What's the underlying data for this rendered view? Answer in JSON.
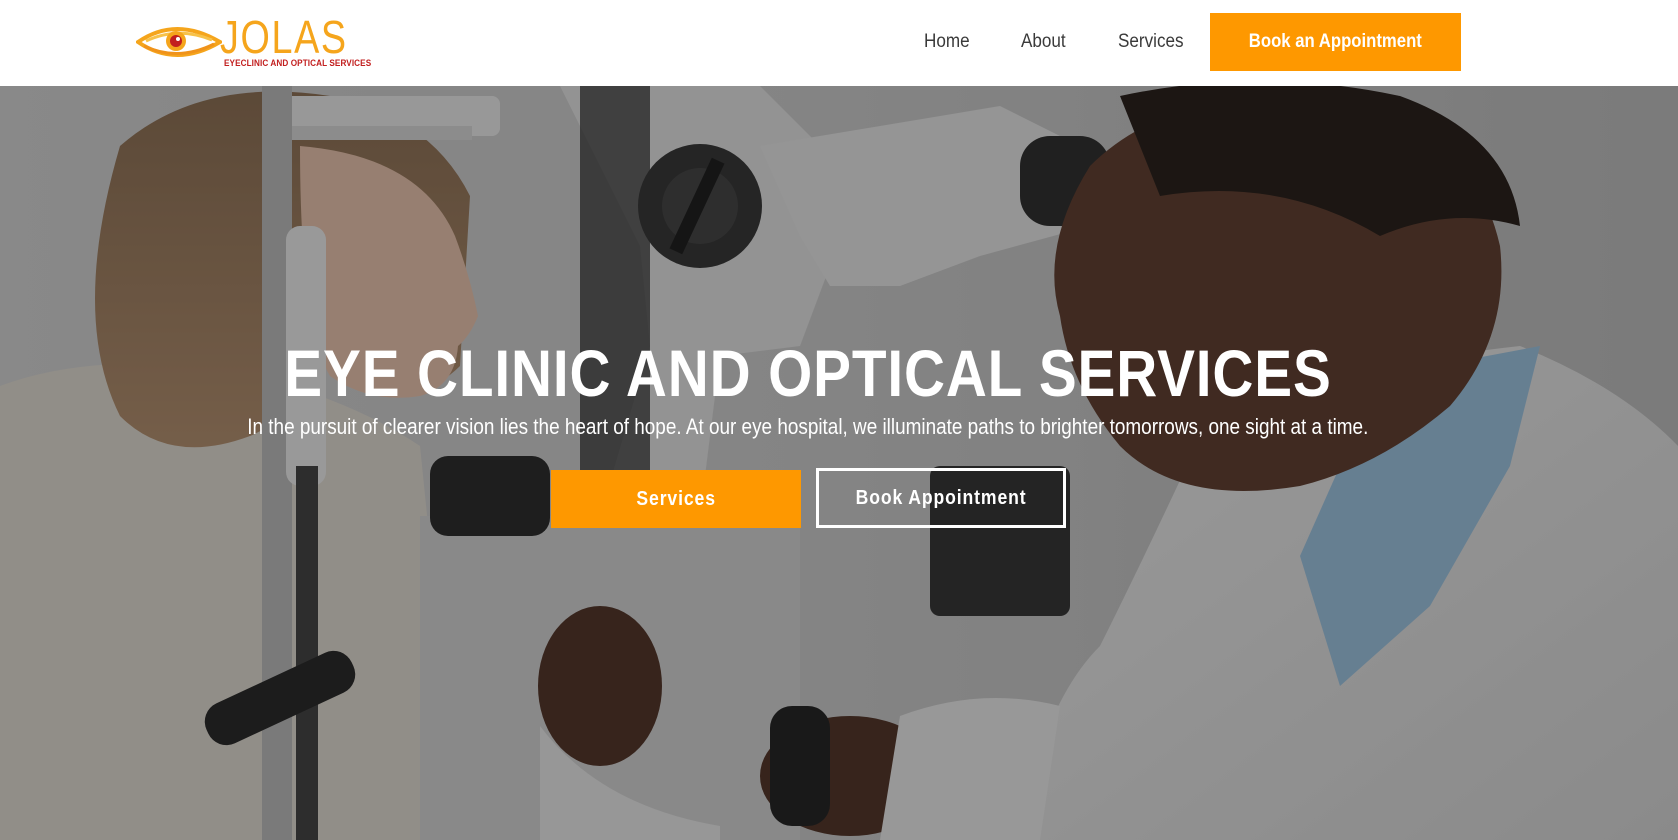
{
  "brand": {
    "name": "JOLAS",
    "tagline": "EYECLINIC AND OPTICAL SERVICES",
    "primary_color": "#fe9800",
    "logo_color": "#f5a51c",
    "tagline_color": "#c21f1f"
  },
  "nav": {
    "items": [
      {
        "label": "Home"
      },
      {
        "label": "About"
      },
      {
        "label": "Services"
      }
    ],
    "cta_label": "Book an Appointment"
  },
  "hero": {
    "title": "EYE CLINIC AND OPTICAL SERVICES",
    "subtitle": "In the pursuit of clearer vision lies the heart of hope. At our eye hospital, we illuminate paths to brighter tomorrows, one sight at a time.",
    "primary_button": "Services",
    "secondary_button": "Book Appointment",
    "background_image": "eye-exam-photo"
  }
}
